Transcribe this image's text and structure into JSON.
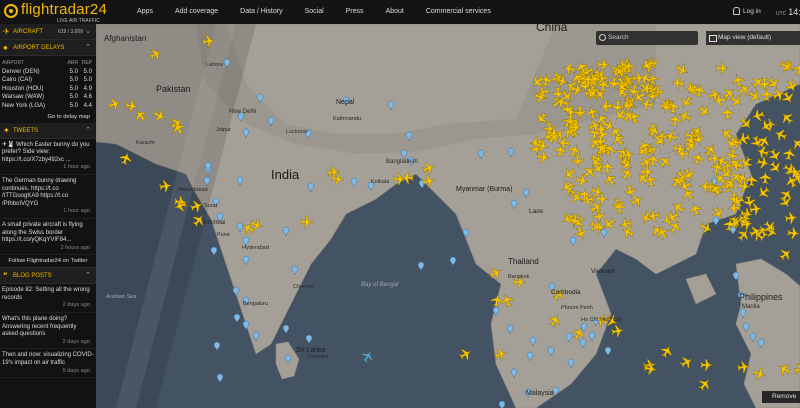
{
  "app": {
    "logo_text": "flightradar24",
    "logo_sub": "LIVE AIR TRAFFIC"
  },
  "nav": [
    "Apps",
    "Add coverage",
    "Data / History",
    "Social",
    "Press",
    "About",
    "Commercial services"
  ],
  "header": {
    "login_label": "Log in",
    "utc_label": "UTC",
    "utc_time": "14:"
  },
  "sidebar": {
    "aircraft": {
      "label": "AIRCRAFT",
      "count": "619 / 3,609"
    },
    "delays": {
      "label": "AIRPORT DELAYS",
      "columns": [
        "AIRPORT",
        "ARR",
        "DEP"
      ],
      "rows": [
        {
          "airport": "Denver (DEN)",
          "arr": "5.0",
          "dep": "5.0"
        },
        {
          "airport": "Cairo (CAI)",
          "arr": "5.0",
          "dep": "5.0"
        },
        {
          "airport": "Houston (HOU)",
          "arr": "5.0",
          "dep": "4.9"
        },
        {
          "airport": "Warsaw (WAW)",
          "arr": "5.0",
          "dep": "4.6"
        },
        {
          "airport": "New York (LGA)",
          "arr": "5.0",
          "dep": "4.4"
        }
      ],
      "link": "Go to delay map"
    },
    "tweets": {
      "label": "TWEETS",
      "items": [
        {
          "text": "✈🐰 Which Easter bunny do you prefer? Side view: https://t.co/X7zby492xc ...",
          "time": "1 hour ago"
        },
        {
          "text": "The German bunny drawing continues. https://t.co /tTTGoogKA9 https://t.co /PIhboIVQYG",
          "time": "1 hour ago"
        },
        {
          "text": "A small private aircraft is flying along the Swiss border https://t.co/yQKqYVIF84...",
          "time": "2 hours ago"
        }
      ],
      "follow": "Follow Flightradar24 on Twitter"
    },
    "blog": {
      "label": "BLOG POSTS",
      "items": [
        {
          "text": "Episode 82: Setting all the wrong records",
          "time": "2 days ago"
        },
        {
          "text": "What's this plane doing? Answering recent frequently asked questions",
          "time": "2 days ago"
        },
        {
          "text": "Then and now: visualizing COVID-19's impact on air traffic",
          "time": "5 days ago"
        }
      ]
    }
  },
  "map": {
    "search_placeholder": "Search",
    "view_label": "Map view (default)",
    "remove_label": "Remove",
    "labels": {
      "countries": [
        "Afghanistan",
        "Pakistan",
        "India",
        "Nepal",
        "China",
        "Myanmar (Burma)",
        "Thailand",
        "Laos",
        "Vietnam",
        "Cambodia",
        "Philippines",
        "Sri Lanka",
        "Malaysia"
      ],
      "cities": [
        "Lahore",
        "New Delhi",
        "Jaipur",
        "Lucknow",
        "Kathmandu",
        "Bangladesh",
        "Kolkata",
        "Ahmedabad",
        "Surat",
        "Mumbai",
        "Pune",
        "Hyderabad",
        "Chennai",
        "Bengaluru",
        "Colombo",
        "Karachi",
        "Bangkok",
        "Phnom Penh",
        "Ho Chi Minh City",
        "Manila"
      ],
      "seas": [
        "Arabian Sea",
        "Bay of Bengal"
      ]
    },
    "colors": {
      "land": "#a49f97",
      "water": "#445364",
      "plane": "#f5c400",
      "pin": "#7fb9e6"
    }
  }
}
